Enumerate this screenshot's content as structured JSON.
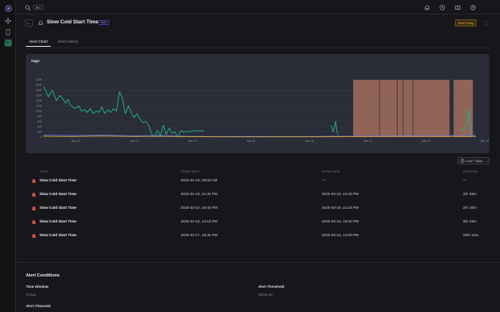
{
  "topbar": {
    "shortcut_hint": "⌘K",
    "avatar_initials": "MG"
  },
  "header": {
    "back_glyph": "←",
    "title": "Slow Cold Start Time",
    "status_badge": "Beta",
    "firing_badge": "Alert Firing",
    "more_glyph": "⋮"
  },
  "tabs": [
    {
      "label": "Alert Chart",
      "active": true
    },
    {
      "label": "Alert History",
      "active": false
    }
  ],
  "chart_data": {
    "type": "line",
    "title": "logs",
    "x_tick_labels": [
      "Mar 12",
      "Mar 13",
      "Mar 14",
      "Mar 15",
      "Mar 16",
      "Mar 17",
      "Mar 18",
      "Mar 19"
    ],
    "y_tick_labels": [
      "220K",
      "200K",
      "180K",
      "160K",
      "140K",
      "120K",
      "100K",
      "80K",
      "60K",
      "40K",
      "20K",
      "0"
    ],
    "ylim": [
      0,
      220000
    ],
    "xlim": [
      0,
      7.4
    ],
    "grid": true,
    "series": [
      {
        "color": "#1fb58f",
        "x": [
          0,
          0.08,
          0.15,
          0.22,
          0.28,
          0.32,
          0.38,
          0.42,
          0.45,
          0.5,
          0.55,
          0.6,
          0.65,
          0.7,
          0.75,
          0.8,
          0.85,
          0.9,
          0.95,
          1.0,
          1.05,
          1.1,
          1.15,
          1.2,
          1.25,
          1.3,
          1.35,
          1.4,
          1.45,
          1.5,
          1.55,
          1.6,
          1.65,
          1.7,
          1.75,
          1.8,
          1.85,
          1.9,
          1.95,
          2.0,
          2.05,
          2.1,
          2.15,
          2.2,
          2.25,
          2.3,
          2.35,
          2.4,
          2.45,
          2.5,
          2.55,
          2.6,
          2.65,
          2.7,
          2.75
        ],
        "y": [
          195000,
          155000,
          180000,
          140000,
          160000,
          150000,
          130000,
          145000,
          125000,
          115000,
          110000,
          120000,
          100000,
          105000,
          95000,
          110000,
          90000,
          100000,
          95000,
          115000,
          90000,
          105000,
          95000,
          110000,
          100000,
          175000,
          150000,
          90000,
          120000,
          95000,
          75000,
          90000,
          70000,
          55000,
          60000,
          45000,
          12000,
          0,
          25000,
          5000,
          45000,
          10000,
          35000,
          15000,
          20000,
          0,
          25000,
          18000,
          22000,
          20000,
          24000,
          23000,
          25000,
          24000,
          24000
        ]
      },
      {
        "color": "#1fb58f",
        "x": [
          4.92,
          4.96,
          5.0,
          5.02,
          5.04
        ],
        "y": [
          45000,
          20000,
          60000,
          25000,
          8000
        ]
      },
      {
        "color": "#1fb58f",
        "x": [
          7.15,
          7.2,
          7.25,
          7.28,
          7.31,
          7.33
        ],
        "y": [
          30000,
          25000,
          50000,
          105000,
          35000,
          10000
        ]
      },
      {
        "color": "#5b6ad8",
        "x": [
          0,
          0.5,
          1.0,
          1.5,
          2.0,
          2.5,
          3.0,
          3.5,
          4.0,
          4.5,
          5.0,
          5.5,
          6.0,
          6.5,
          7.0,
          7.4
        ],
        "y": [
          8000,
          6000,
          7000,
          5000,
          6000,
          3000,
          2000,
          2500,
          2000,
          2000,
          3000,
          4000,
          5000,
          5500,
          6000,
          6000
        ]
      },
      {
        "color": "#d9a13a",
        "x": [
          0,
          0.5,
          1.0,
          1.5,
          2.0,
          2.5,
          3.0,
          3.5,
          4.0,
          4.5,
          5.0,
          5.5,
          6.0,
          6.5,
          7.0,
          7.4
        ],
        "y": [
          3000,
          2000,
          4000,
          2000,
          3000,
          1500,
          1000,
          1000,
          1000,
          1000,
          1500,
          2000,
          2500,
          2500,
          2500,
          2500
        ]
      }
    ],
    "alert_bands": [
      {
        "start": 5.3,
        "end": 5.75,
        "color": "#a8705f"
      },
      {
        "start": 5.76,
        "end": 6.05,
        "color": "#a8705f"
      },
      {
        "start": 6.06,
        "end": 6.15,
        "color": "#a8705f"
      },
      {
        "start": 6.16,
        "end": 6.32,
        "color": "#a8705f"
      },
      {
        "start": 6.33,
        "end": 6.95,
        "color": "#a8705f"
      },
      {
        "start": 7.02,
        "end": 7.35,
        "color": "#a8705f"
      }
    ]
  },
  "range_select": {
    "label": "Last 7 days"
  },
  "table": {
    "headers": [
      "STATE",
      "FIRING SINCE",
      "FIRING UNTIL",
      "DURATION"
    ],
    "rows": [
      {
        "name": "Slow Cold Start Time",
        "firing_since": "2025-03-19, 09:00 AM",
        "firing_until": "—",
        "duration": "—"
      },
      {
        "name": "Slow Cold Start Time",
        "firing_since": "2025-03-18, 21:45 PM",
        "firing_until": "2025-03-18, 22:30 PM",
        "duration": "1hr 45m"
      },
      {
        "name": "Slow Cold Start Time",
        "firing_since": "2025-03-18, 18:45 PM",
        "firing_until": "2025-03-18, 21:15 PM",
        "duration": "2hr 30m"
      },
      {
        "name": "Slow Cold Start Time",
        "firing_since": "2025-03-18, 14:15 PM",
        "firing_until": "2025-03-18, 18:00 PM",
        "duration": "3hr 45m"
      },
      {
        "name": "Slow Cold Start Time",
        "firing_since": "2025-03-17, 18:45 PM",
        "firing_until": "2025-03-18, 14:00 PM",
        "duration": "19hr 15m"
      }
    ]
  },
  "conditions": {
    "section_title": "Alert Conditions",
    "time_window_label": "Time Window",
    "time_window_value": "1 Hour",
    "threshold_label": "Alert Threshold",
    "threshold_value": "Above 40",
    "channels_label": "Alert Channels"
  }
}
